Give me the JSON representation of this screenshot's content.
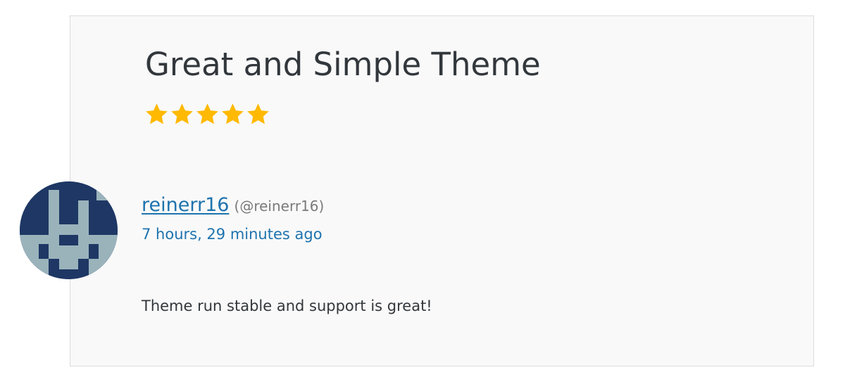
{
  "review": {
    "title": "Great and Simple Theme",
    "rating": 5,
    "rating_max": 5,
    "star_color": "#ffb900",
    "author": {
      "name": "reinerr16",
      "handle": "(@reinerr16)"
    },
    "timestamp": "7 hours, 29 minutes ago",
    "body": "Theme run stable and support is great!"
  },
  "colors": {
    "link": "#1e73ae",
    "text": "#32373c",
    "card_bg": "#f9f9f9",
    "avatar_bg": "#1e3764",
    "avatar_fg": "#9ab3bb"
  }
}
